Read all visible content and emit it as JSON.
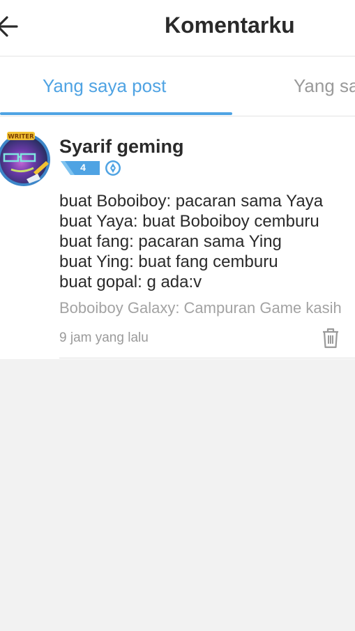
{
  "header": {
    "title": "Komentarku",
    "back_icon": "arrow-left-icon"
  },
  "tabs": [
    {
      "label": "Yang saya post",
      "active": true
    },
    {
      "label": "Yang sa",
      "active": false
    }
  ],
  "comment": {
    "username": "Syarif geming",
    "avatar_badge_text": "WRITER",
    "level": "4",
    "writer_badge_icon": "pen-nib-icon",
    "lines": [
      "buat Boboiboy: pacaran sama Yaya",
      "buat Yaya: buat Boboiboy cemburu",
      "buat fang: pacaran sama Ying",
      "buat Ying: buat fang cemburu",
      "buat gopal: g ada:v"
    ],
    "source": "Boboiboy Galaxy: Campuran Game kasih",
    "time": "9 jam yang lalu",
    "delete_icon": "trash-icon"
  },
  "colors": {
    "accent": "#4fa3e3",
    "text": "#2a2a2a",
    "muted": "#9a9a9a",
    "background": "#f2f2f2"
  }
}
